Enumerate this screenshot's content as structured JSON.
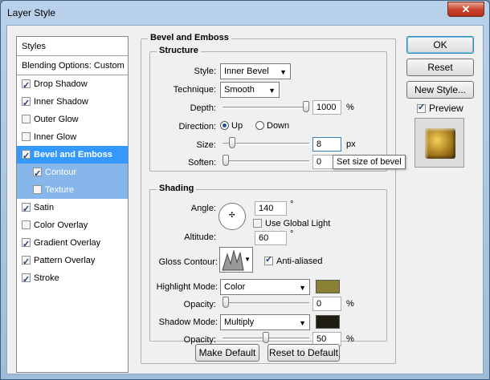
{
  "window": {
    "title": "Layer Style",
    "close_label": "✕"
  },
  "left": {
    "header": "Styles",
    "blending": "Blending Options: Custom",
    "items": [
      {
        "label": "Drop Shadow",
        "checked": true
      },
      {
        "label": "Inner Shadow",
        "checked": true
      },
      {
        "label": "Outer Glow",
        "checked": false
      },
      {
        "label": "Inner Glow",
        "checked": false
      },
      {
        "label": "Bevel and Emboss",
        "checked": true
      },
      {
        "label": "Contour",
        "checked": true
      },
      {
        "label": "Texture",
        "checked": false
      },
      {
        "label": "Satin",
        "checked": true
      },
      {
        "label": "Color Overlay",
        "checked": false
      },
      {
        "label": "Gradient Overlay",
        "checked": true
      },
      {
        "label": "Pattern Overlay",
        "checked": true
      },
      {
        "label": "Stroke",
        "checked": true
      }
    ]
  },
  "panel": {
    "title": "Bevel and Emboss",
    "structure": {
      "title": "Structure",
      "style_label": "Style:",
      "style_value": "Inner Bevel",
      "technique_label": "Technique:",
      "technique_value": "Smooth",
      "depth_label": "Depth:",
      "depth_value": "1000",
      "depth_unit": "%",
      "depth_level": 1.0,
      "direction_label": "Direction:",
      "dir_up": "Up",
      "dir_down": "Down",
      "size_label": "Size:",
      "size_value": "8",
      "size_unit": "px",
      "size_level": 0.08,
      "soften_label": "Soften:",
      "soften_value": "0",
      "soften_unit": "px",
      "soften_level": 0.0
    },
    "shading": {
      "title": "Shading",
      "angle_label": "Angle:",
      "angle_value": "140",
      "angle_unit": "°",
      "global_light": "Use Global Light",
      "altitude_label": "Altitude:",
      "altitude_value": "60",
      "altitude_unit": "°",
      "gloss_label": "Gloss Contour:",
      "anti_aliased": "Anti-aliased",
      "highlight_label": "Highlight Mode:",
      "highlight_value": "Color",
      "highlight_color": "#8a8136",
      "hl_opacity_label": "Opacity:",
      "hl_opacity_value": "0",
      "hl_opacity_unit": "%",
      "hl_opacity_level": 0.0,
      "shadow_label": "Shadow Mode:",
      "shadow_value": "Multiply",
      "shadow_color": "#1f1d12",
      "sh_opacity_label": "Opacity:",
      "sh_opacity_value": "50",
      "sh_opacity_unit": "%",
      "sh_opacity_level": 0.5
    },
    "make_default": "Make Default",
    "reset_default": "Reset to Default"
  },
  "buttons": {
    "ok": "OK",
    "reset": "Reset",
    "new_style": "New Style...",
    "preview": "Preview"
  },
  "tooltip": "Set size of bevel"
}
